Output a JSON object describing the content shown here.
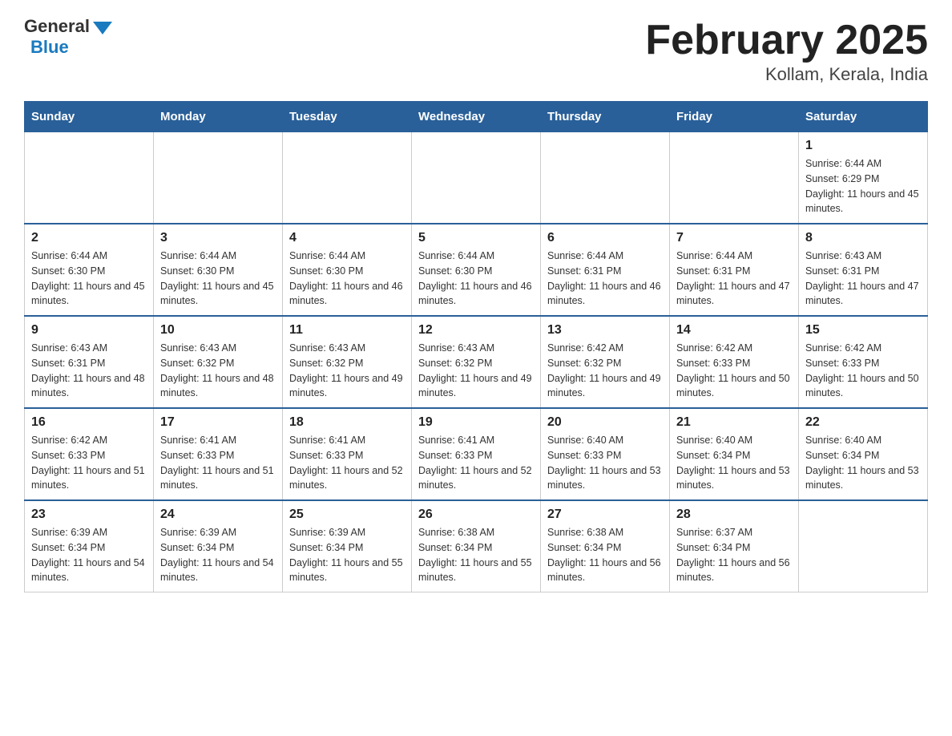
{
  "header": {
    "logo_general": "General",
    "logo_blue": "Blue",
    "title": "February 2025",
    "subtitle": "Kollam, Kerala, India"
  },
  "days_of_week": [
    "Sunday",
    "Monday",
    "Tuesday",
    "Wednesday",
    "Thursday",
    "Friday",
    "Saturday"
  ],
  "weeks": [
    [
      {
        "day": "",
        "info": ""
      },
      {
        "day": "",
        "info": ""
      },
      {
        "day": "",
        "info": ""
      },
      {
        "day": "",
        "info": ""
      },
      {
        "day": "",
        "info": ""
      },
      {
        "day": "",
        "info": ""
      },
      {
        "day": "1",
        "info": "Sunrise: 6:44 AM\nSunset: 6:29 PM\nDaylight: 11 hours and 45 minutes."
      }
    ],
    [
      {
        "day": "2",
        "info": "Sunrise: 6:44 AM\nSunset: 6:30 PM\nDaylight: 11 hours and 45 minutes."
      },
      {
        "day": "3",
        "info": "Sunrise: 6:44 AM\nSunset: 6:30 PM\nDaylight: 11 hours and 45 minutes."
      },
      {
        "day": "4",
        "info": "Sunrise: 6:44 AM\nSunset: 6:30 PM\nDaylight: 11 hours and 46 minutes."
      },
      {
        "day": "5",
        "info": "Sunrise: 6:44 AM\nSunset: 6:30 PM\nDaylight: 11 hours and 46 minutes."
      },
      {
        "day": "6",
        "info": "Sunrise: 6:44 AM\nSunset: 6:31 PM\nDaylight: 11 hours and 46 minutes."
      },
      {
        "day": "7",
        "info": "Sunrise: 6:44 AM\nSunset: 6:31 PM\nDaylight: 11 hours and 47 minutes."
      },
      {
        "day": "8",
        "info": "Sunrise: 6:43 AM\nSunset: 6:31 PM\nDaylight: 11 hours and 47 minutes."
      }
    ],
    [
      {
        "day": "9",
        "info": "Sunrise: 6:43 AM\nSunset: 6:31 PM\nDaylight: 11 hours and 48 minutes."
      },
      {
        "day": "10",
        "info": "Sunrise: 6:43 AM\nSunset: 6:32 PM\nDaylight: 11 hours and 48 minutes."
      },
      {
        "day": "11",
        "info": "Sunrise: 6:43 AM\nSunset: 6:32 PM\nDaylight: 11 hours and 49 minutes."
      },
      {
        "day": "12",
        "info": "Sunrise: 6:43 AM\nSunset: 6:32 PM\nDaylight: 11 hours and 49 minutes."
      },
      {
        "day": "13",
        "info": "Sunrise: 6:42 AM\nSunset: 6:32 PM\nDaylight: 11 hours and 49 minutes."
      },
      {
        "day": "14",
        "info": "Sunrise: 6:42 AM\nSunset: 6:33 PM\nDaylight: 11 hours and 50 minutes."
      },
      {
        "day": "15",
        "info": "Sunrise: 6:42 AM\nSunset: 6:33 PM\nDaylight: 11 hours and 50 minutes."
      }
    ],
    [
      {
        "day": "16",
        "info": "Sunrise: 6:42 AM\nSunset: 6:33 PM\nDaylight: 11 hours and 51 minutes."
      },
      {
        "day": "17",
        "info": "Sunrise: 6:41 AM\nSunset: 6:33 PM\nDaylight: 11 hours and 51 minutes."
      },
      {
        "day": "18",
        "info": "Sunrise: 6:41 AM\nSunset: 6:33 PM\nDaylight: 11 hours and 52 minutes."
      },
      {
        "day": "19",
        "info": "Sunrise: 6:41 AM\nSunset: 6:33 PM\nDaylight: 11 hours and 52 minutes."
      },
      {
        "day": "20",
        "info": "Sunrise: 6:40 AM\nSunset: 6:33 PM\nDaylight: 11 hours and 53 minutes."
      },
      {
        "day": "21",
        "info": "Sunrise: 6:40 AM\nSunset: 6:34 PM\nDaylight: 11 hours and 53 minutes."
      },
      {
        "day": "22",
        "info": "Sunrise: 6:40 AM\nSunset: 6:34 PM\nDaylight: 11 hours and 53 minutes."
      }
    ],
    [
      {
        "day": "23",
        "info": "Sunrise: 6:39 AM\nSunset: 6:34 PM\nDaylight: 11 hours and 54 minutes."
      },
      {
        "day": "24",
        "info": "Sunrise: 6:39 AM\nSunset: 6:34 PM\nDaylight: 11 hours and 54 minutes."
      },
      {
        "day": "25",
        "info": "Sunrise: 6:39 AM\nSunset: 6:34 PM\nDaylight: 11 hours and 55 minutes."
      },
      {
        "day": "26",
        "info": "Sunrise: 6:38 AM\nSunset: 6:34 PM\nDaylight: 11 hours and 55 minutes."
      },
      {
        "day": "27",
        "info": "Sunrise: 6:38 AM\nSunset: 6:34 PM\nDaylight: 11 hours and 56 minutes."
      },
      {
        "day": "28",
        "info": "Sunrise: 6:37 AM\nSunset: 6:34 PM\nDaylight: 11 hours and 56 minutes."
      },
      {
        "day": "",
        "info": ""
      }
    ]
  ]
}
